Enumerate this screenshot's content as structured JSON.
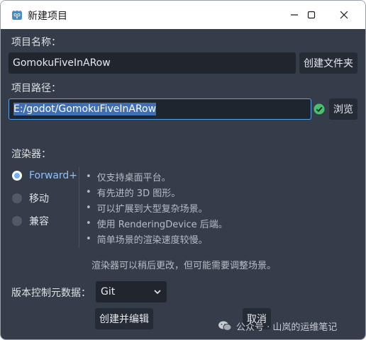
{
  "window": {
    "title": "新建项目",
    "icon": "godot-icon"
  },
  "project_name": {
    "label": "项目名称：",
    "value": "GomokuFiveInARow",
    "create_folder_label": "创建文件夹"
  },
  "project_path": {
    "label": "项目路径：",
    "value": "E:/godot/GomokuFiveInARow",
    "status_icon": "check-circle-icon",
    "browse_label": "浏览"
  },
  "renderer": {
    "label": "渲染器：",
    "options": [
      {
        "label": "Forward+",
        "selected": true
      },
      {
        "label": "移动",
        "selected": false
      },
      {
        "label": "兼容",
        "selected": false
      }
    ],
    "features": [
      "仅支持桌面平台。",
      "有先进的 3D 图形。",
      "可以扩展到大型复杂场景。",
      "使用 RenderingDevice 后端。",
      "简单场景的渲染速度较慢。"
    ],
    "bullet": "•",
    "note": "渲染器可以稍后更改，但可能需要调整场景。"
  },
  "vcs": {
    "label": "版本控制元数据：",
    "selected": "Git"
  },
  "actions": {
    "create_edit_label": "创建并编辑",
    "cancel_label": "取消"
  },
  "watermark": {
    "text": "公众号 · 山岚的运维笔记"
  },
  "colors": {
    "background": "#363d4a",
    "input_bg": "#21262e",
    "accent": "#5d9fe3",
    "success": "#45c36a"
  }
}
